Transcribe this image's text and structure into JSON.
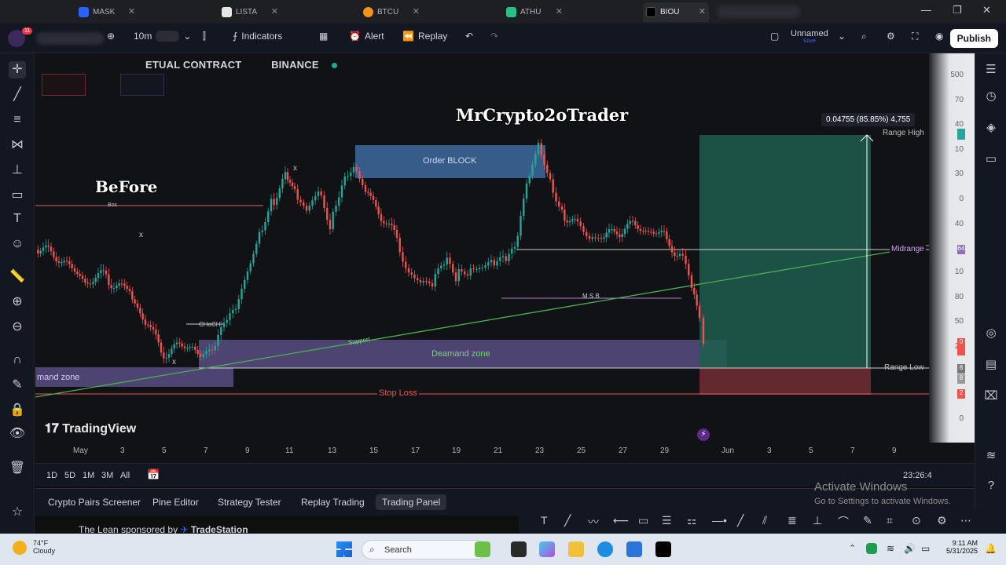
{
  "browser": {
    "tabs": [
      {
        "label": "MASK",
        "active": false
      },
      {
        "label": "LISTA",
        "active": false
      },
      {
        "label": "BTCU",
        "active": false
      },
      {
        "label": "ATHU",
        "active": false
      },
      {
        "label": "BIOU",
        "active": true
      }
    ]
  },
  "toolbar": {
    "interval": "10m",
    "indicators": "Indicators",
    "alert": "Alert",
    "replay": "Replay",
    "layout_name": "Unnamed",
    "layout_status": "Save",
    "publish": "Publish",
    "notification_count": "11"
  },
  "chart": {
    "symbol_text": "ETUAL CONTRACT",
    "exchange": "BINANCE",
    "watermark": "MrCrypto2oTrader",
    "before_label": "BeFore",
    "order_block": "Order BLOCK",
    "demand_zone": "Deamand zone",
    "demand_zone_left": "mand zone",
    "stop_loss": "Stop Loss",
    "support": "Support",
    "choch": "CHoCH",
    "bos": "Bos",
    "msb": "M S B",
    "range_high": "Range High",
    "range_low": "Range Low",
    "midrange": "Midrange",
    "measure": "0.04755 (85.85%) 4,755",
    "x_marks": [
      "x",
      "x",
      "x"
    ],
    "tradingview_logo": "TradingView",
    "price_labels": [
      "500",
      "70",
      "40",
      "10",
      "30",
      "0",
      "40",
      "10",
      "80",
      "50",
      "20",
      "0"
    ],
    "price_boxes": [
      "64",
      "0",
      "8",
      "8",
      "2"
    ]
  },
  "time_axis": {
    "labels": [
      "May",
      "3",
      "5",
      "7",
      "9",
      "11",
      "13",
      "15",
      "17",
      "19",
      "21",
      "23",
      "25",
      "27",
      "29",
      "Jun",
      "3",
      "5",
      "7",
      "9"
    ],
    "countdown": "23:26:4"
  },
  "range_bar": {
    "buttons": [
      "1D",
      "5D",
      "1M",
      "3M",
      "All"
    ]
  },
  "bottom_tabs": [
    {
      "label": "Crypto Pairs Screener",
      "active": false
    },
    {
      "label": "Pine Editor",
      "active": false
    },
    {
      "label": "Strategy Tester",
      "active": false
    },
    {
      "label": "Replay Trading",
      "active": false
    },
    {
      "label": "Trading Panel",
      "active": true
    }
  ],
  "sponsor_text": "The Lean sponsored by",
  "sponsor_brand": "TradeStation",
  "activate_windows": {
    "title": "Activate Windows",
    "subtitle": "Go to Settings to activate Windows."
  },
  "taskbar": {
    "weather_temp": "74°F",
    "weather_desc": "Cloudy",
    "search_placeholder": "Search",
    "time": "9:11 AM",
    "date": "5/31/2025"
  },
  "colors": {
    "bull": "#26a69a",
    "bear": "#ef5350",
    "order_block": "#3d6a9e",
    "demand": "#6a5a9a",
    "target": "#1f5e4e",
    "stop": "#6e2c32"
  }
}
